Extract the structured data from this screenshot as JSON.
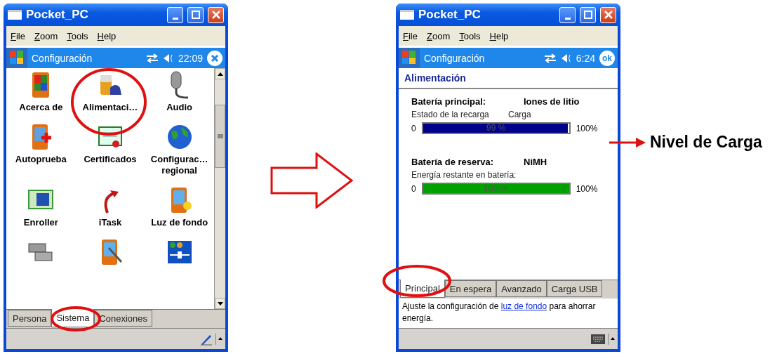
{
  "windows": [
    {
      "kind": "icon_grid",
      "title": "Pocket_PC",
      "menu": [
        "File",
        "Zoom",
        "Tools",
        "Help"
      ],
      "nav": {
        "title": "Configuración",
        "time": "22:09",
        "action": {
          "kind": "close"
        }
      },
      "items": [
        {
          "kind": "app",
          "label": "Acerca de"
        },
        {
          "kind": "app",
          "label": "Alimentaci…"
        },
        {
          "kind": "app",
          "label": "Audio"
        },
        {
          "kind": "app",
          "label": "Autoprueba"
        },
        {
          "kind": "app",
          "label": "Certificados"
        },
        {
          "kind": "app",
          "label": "Configurac… regional"
        },
        {
          "kind": "app",
          "label": "Enroller"
        },
        {
          "kind": "app",
          "label": "iTask"
        },
        {
          "kind": "app",
          "label": "Luz de fondo"
        },
        {
          "kind": "cut_off"
        },
        {
          "kind": "cut_off"
        },
        {
          "kind": "cut_off"
        }
      ],
      "tabs": [
        {
          "label": "Persona",
          "selected": false
        },
        {
          "label": "Sistema",
          "selected": true
        },
        {
          "label": "Conexiones",
          "selected": false
        }
      ]
    },
    {
      "kind": "power",
      "title": "Pocket_PC",
      "menu": [
        "File",
        "Zoom",
        "Tools",
        "Help"
      ],
      "nav": {
        "title": "Configuración",
        "time": "6:24",
        "action": {
          "kind": "ok",
          "label": "ok"
        }
      },
      "header": "Alimentación",
      "batteries": [
        {
          "name": "Batería principal:",
          "type": "Iones de litio",
          "status_label": "Estado de la recarga",
          "status": "Carga",
          "min": "0",
          "max": "100%",
          "reading": "99 %",
          "level": 0.99,
          "color": "#00008b"
        },
        {
          "name": "Batería de reserva:",
          "type": "NiMH",
          "status_label": "Energía restante en batería:",
          "min": "0",
          "max": "100%",
          "reading": "100 %",
          "level": 1,
          "color": "#00a000"
        }
      ],
      "tabs": [
        {
          "label": "Principal",
          "selected": true
        },
        {
          "label": "En espera",
          "selected": false
        },
        {
          "label": "Avanzado",
          "selected": false
        },
        {
          "label": "Carga USB",
          "selected": false
        }
      ],
      "note": {
        "before": "Ajuste la configuración de ",
        "link": "luz de fondo",
        "after": " para ahorrar energía."
      }
    }
  ],
  "annotation": {
    "label": "Nivel de Carga"
  }
}
